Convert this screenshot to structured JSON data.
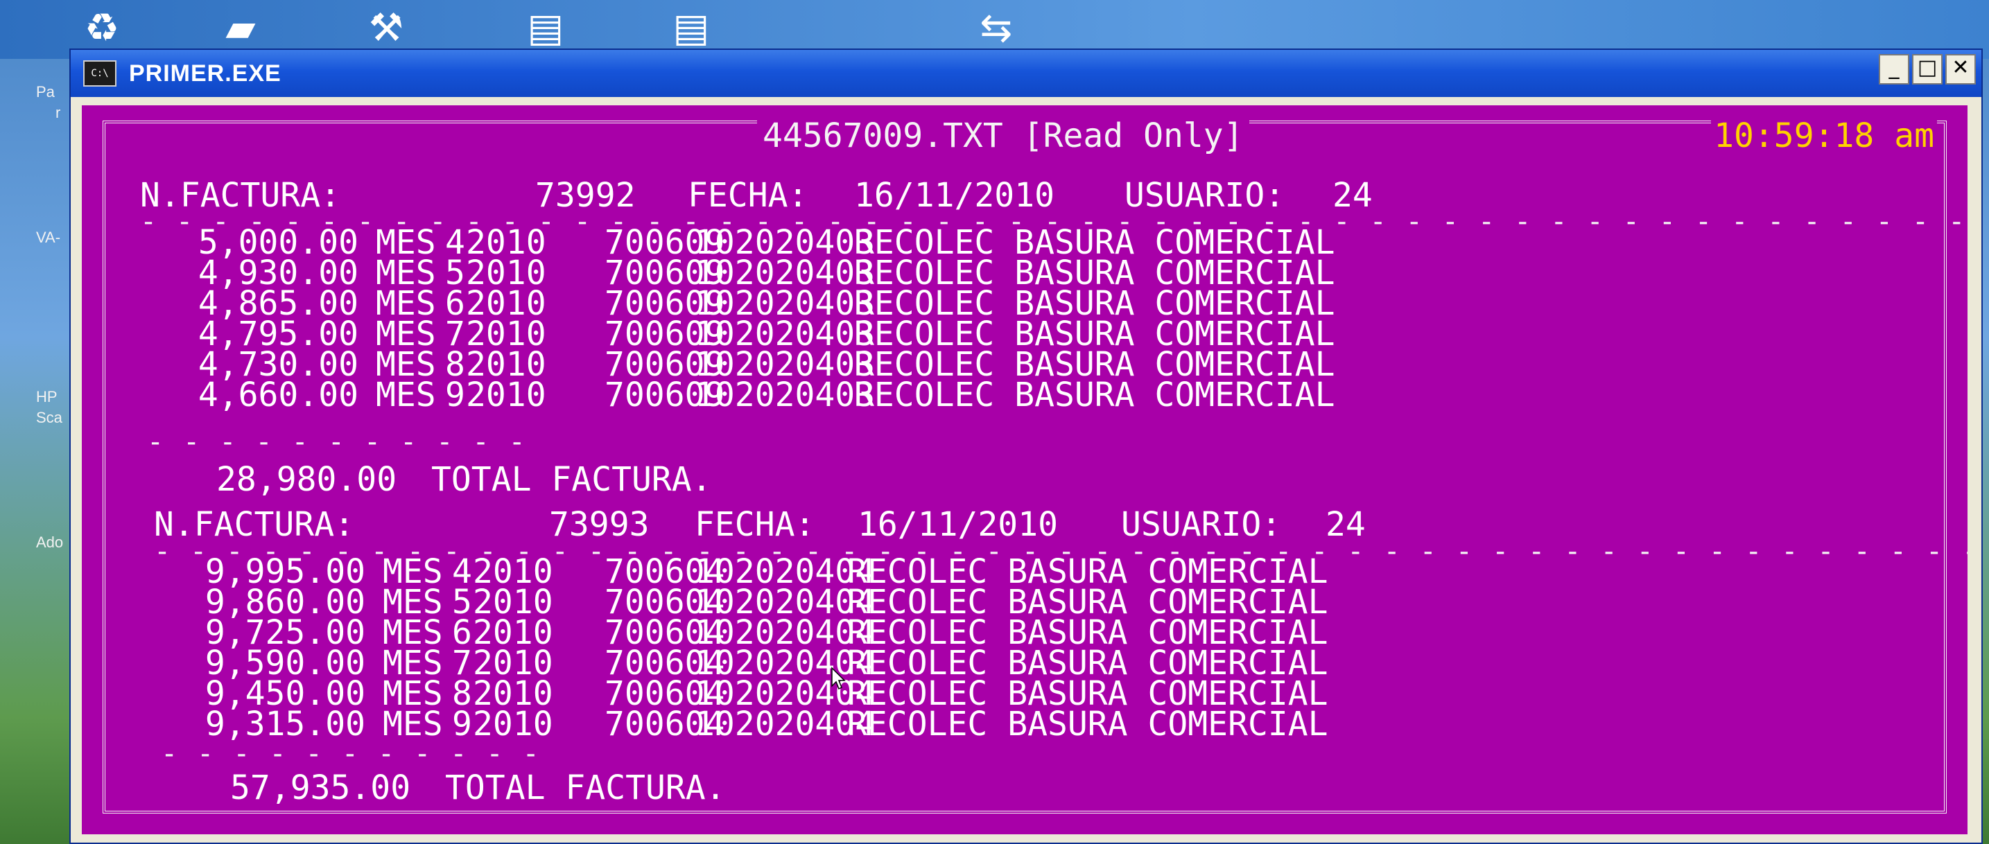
{
  "window": {
    "title": "PRIMER.EXE",
    "icon_label": "C:\\",
    "buttons": {
      "minimize": "_",
      "maximize": "□",
      "close": "✕"
    }
  },
  "console": {
    "file_title": "44567009.TXT [Read Only]",
    "clock": "10:59:18 am",
    "invoices": [
      {
        "header": {
          "label_factura": "N.FACTURA:",
          "factura": "73992",
          "label_fecha": "FECHA:",
          "fecha": "16/11/2010",
          "label_usuario": "USUARIO:",
          "usuario": "24"
        },
        "rows": [
          {
            "amount": "5,000.00",
            "mes_label": "MES",
            "mes": "4",
            "year": "2010",
            "code1": "700609",
            "code2": "102020403",
            "desc": "RECOLEC BASURA COMERCIAL"
          },
          {
            "amount": "4,930.00",
            "mes_label": "MES",
            "mes": "5",
            "year": "2010",
            "code1": "700609",
            "code2": "102020403",
            "desc": "RECOLEC BASURA COMERCIAL"
          },
          {
            "amount": "4,865.00",
            "mes_label": "MES",
            "mes": "6",
            "year": "2010",
            "code1": "700609",
            "code2": "102020403",
            "desc": "RECOLEC BASURA COMERCIAL"
          },
          {
            "amount": "4,795.00",
            "mes_label": "MES",
            "mes": "7",
            "year": "2010",
            "code1": "700609",
            "code2": "102020403",
            "desc": "RECOLEC BASURA COMERCIAL"
          },
          {
            "amount": "4,730.00",
            "mes_label": "MES",
            "mes": "8",
            "year": "2010",
            "code1": "700609",
            "code2": "102020403",
            "desc": "RECOLEC BASURA COMERCIAL"
          },
          {
            "amount": "4,660.00",
            "mes_label": "MES",
            "mes": "9",
            "year": "2010",
            "code1": "700609",
            "code2": "102020403",
            "desc": "RECOLEC BASURA COMERCIAL"
          }
        ],
        "total": "28,980.00",
        "total_label": "TOTAL FACTURA."
      },
      {
        "header": {
          "label_factura": "N.FACTURA:",
          "factura": "73993",
          "label_fecha": "FECHA:",
          "fecha": "16/11/2010",
          "label_usuario": "USUARIO:",
          "usuario": "24"
        },
        "rows": [
          {
            "amount": "9,995.00",
            "mes_label": "MES",
            "mes": "4",
            "year": "2010",
            "code1": "700604",
            "code2": "102020404",
            "desc": "RECOLEC BASURA COMERCIAL"
          },
          {
            "amount": "9,860.00",
            "mes_label": "MES",
            "mes": "5",
            "year": "2010",
            "code1": "700604",
            "code2": "102020404",
            "desc": "RECOLEC BASURA COMERCIAL"
          },
          {
            "amount": "9,725.00",
            "mes_label": "MES",
            "mes": "6",
            "year": "2010",
            "code1": "700604",
            "code2": "102020404",
            "desc": "RECOLEC BASURA COMERCIAL"
          },
          {
            "amount": "9,590.00",
            "mes_label": "MES",
            "mes": "7",
            "year": "2010",
            "code1": "700604",
            "code2": "102020404",
            "desc": "RECOLEC BASURA COMERCIAL"
          },
          {
            "amount": "9,450.00",
            "mes_label": "MES",
            "mes": "8",
            "year": "2010",
            "code1": "700604",
            "code2": "102020404",
            "desc": "RECOLEC BASURA COMERCIAL"
          },
          {
            "amount": "9,315.00",
            "mes_label": "MES",
            "mes": "9",
            "year": "2010",
            "code1": "700604",
            "code2": "102020404",
            "desc": "RECOLEC BASURA COMERCIAL"
          }
        ],
        "total": "57,935.00",
        "total_label": "TOTAL FACTURA."
      }
    ]
  },
  "desktop": {
    "left_labels": [
      "Pa",
      "r",
      "VA-",
      "HP",
      "Sca",
      "Ado"
    ],
    "icons": [
      "recycle-bin-icon",
      "folder-icon",
      "app-shortcut-icon",
      "word-document-icon",
      "word-document-icon",
      "teamviewer-icon"
    ]
  }
}
